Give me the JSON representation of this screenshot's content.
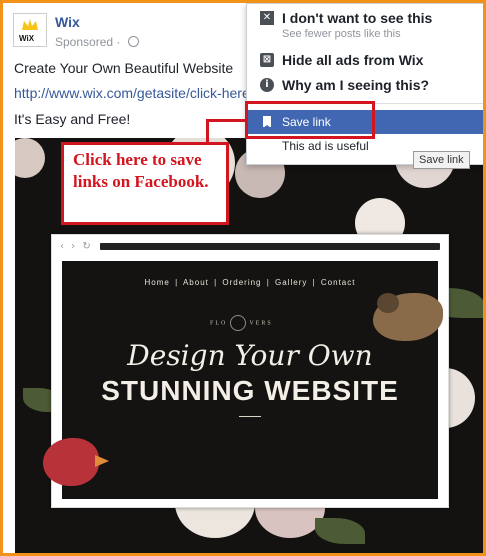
{
  "post": {
    "page_name": "Wix",
    "sponsored": "Sponsored · ",
    "headline": "Create Your Own Beautiful Website",
    "link": "http://www.wix.com/getasite/click-here",
    "tagline": "It's Easy and Free!",
    "logo_text": "WiX"
  },
  "ad_site": {
    "nav": "Home | About | Ordering | Gallery | Contact",
    "brand_left": "FLO",
    "brand_right": "VERS",
    "heading_script": "Design Your Own",
    "heading_bold": "STUNNING WEBSITE"
  },
  "menu": {
    "hide_post": "I don't want to see this",
    "hide_post_sub": "See fewer posts like this",
    "hide_all": "Hide all ads from Wix",
    "why": "Why am I seeing this?",
    "save_link": "Save link",
    "useful": "This ad is useful"
  },
  "tooltip": "Save link",
  "callout": "Click here to save links on Facebook.",
  "colors": {
    "frame_orange": "#f39218",
    "facebook_blue": "#4267b2",
    "link_blue": "#365899",
    "annotation_red": "#d3151f"
  }
}
